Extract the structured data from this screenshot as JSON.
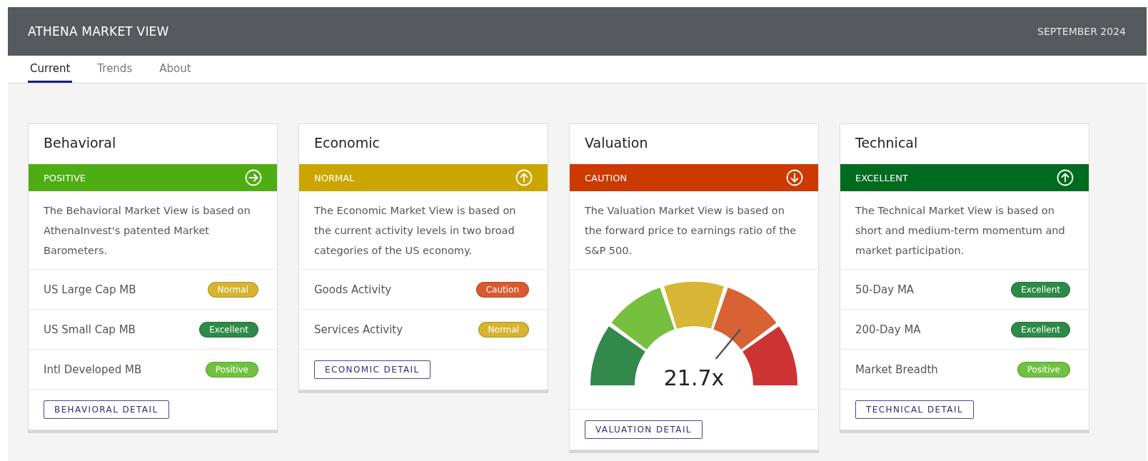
{
  "header": {
    "title": "ATHENA MARKET VIEW",
    "date": "SEPTEMBER 2024"
  },
  "tabs": [
    {
      "label": "Current",
      "selected": true
    },
    {
      "label": "Trends",
      "selected": false
    },
    {
      "label": "About",
      "selected": false
    }
  ],
  "cards": [
    {
      "kind": "rows",
      "title": "Behavioral",
      "status": "POSITIVE",
      "color": "#4fad14",
      "arrow": {
        "kind": "right"
      },
      "description": "The Behavioral Market View is based on AthenaInvest's patented Market Barometers.",
      "rows": [
        {
          "label": "US Large Cap MB",
          "badge": "Normal",
          "color": "#d6b430"
        },
        {
          "label": "US Small Cap MB",
          "badge": "Excellent",
          "color": "#2e8a47"
        },
        {
          "label": "Intl Developed MB",
          "badge": "Positive",
          "color": "#6fc13f"
        }
      ],
      "button": "BEHAVIORAL DETAIL"
    },
    {
      "kind": "rows",
      "title": "Economic",
      "status": "NORMAL",
      "color": "#cca600",
      "arrow": {
        "kind": "up"
      },
      "description": "The Economic Market View is based on the current activity levels in two broad categories of the US economy.",
      "rows": [
        {
          "label": "Goods Activity",
          "badge": "Caution",
          "color": "#da5a30"
        },
        {
          "label": "Services Activity",
          "badge": "Normal",
          "color": "#d6b430"
        }
      ],
      "button": "ECONOMIC DETAIL"
    },
    {
      "kind": "gauge",
      "title": "Valuation",
      "status": "CAUTION",
      "color": "#cc3a00",
      "arrow": {
        "kind": "down"
      },
      "description": "The Valuation Market View is based on the forward price to earnings ratio of the S&P 500.",
      "gauge": {
        "reading": "21.7x"
      },
      "button": "VALUATION DETAIL"
    },
    {
      "kind": "rows",
      "title": "Technical",
      "status": "EXCELLENT",
      "color": "#006b1e",
      "arrow": {
        "kind": "up"
      },
      "description": "The Technical Market View is based on short and medium-term momentum and market participation.",
      "rows": [
        {
          "label": "50-Day MA",
          "badge": "Excellent",
          "color": "#2e8a47"
        },
        {
          "label": "200-Day MA",
          "badge": "Excellent",
          "color": "#2e8a47"
        },
        {
          "label": "Market Breadth",
          "badge": "Positive",
          "color": "#6fc13f"
        }
      ],
      "button": "TECHNICAL DETAIL"
    }
  ]
}
